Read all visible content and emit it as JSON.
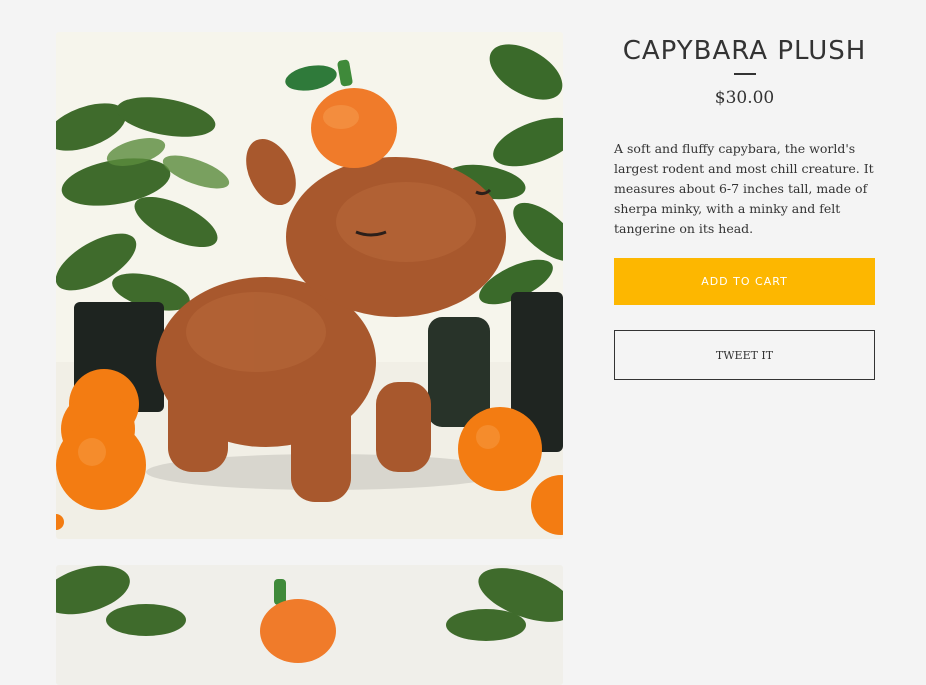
{
  "product": {
    "title": "CAPYBARA PLUSH",
    "price": "$30.00",
    "description": "A soft and fluffy capybara, the world's largest rodent and most chill creature. It measures about 6-7 inches tall, made of sherpa minky, with a minky and felt tangerine on its head."
  },
  "actions": {
    "add_to_cart_label": "ADD TO CART",
    "tweet_label": "TWEET IT"
  },
  "colors": {
    "accent": "#fdb700",
    "background": "#f4f4f4",
    "text": "#333333"
  }
}
